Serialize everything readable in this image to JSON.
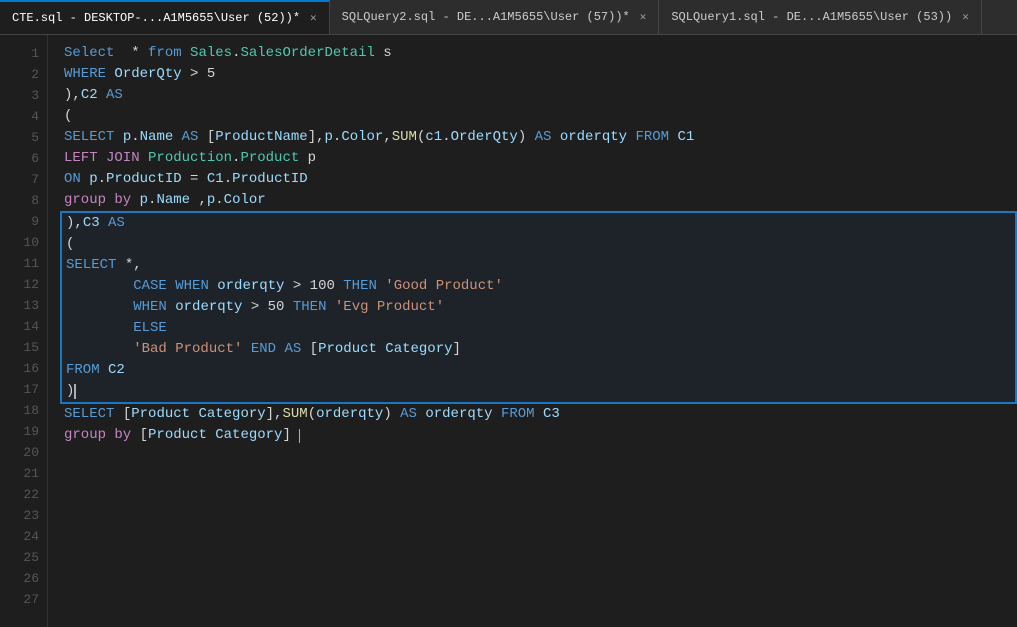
{
  "tabs": [
    {
      "id": "tab1",
      "label": "CTE.sql - DESKTOP-...A1M5655\\User (52))",
      "active": true,
      "modified": true
    },
    {
      "id": "tab2",
      "label": "SQLQuery2.sql - DE...A1M5655\\User (57))",
      "active": false,
      "modified": true
    },
    {
      "id": "tab3",
      "label": "SQLQuery1.sql - DE...A1M5655\\User (53))",
      "active": false,
      "modified": false
    }
  ],
  "lines": [
    {
      "num": 1,
      "content": ""
    },
    {
      "num": 2,
      "content": ""
    },
    {
      "num": 3,
      "content": ""
    },
    {
      "num": 4,
      "content": ""
    },
    {
      "num": 5,
      "content": ""
    },
    {
      "num": 6,
      "content": ""
    },
    {
      "num": 7,
      "content": ""
    },
    {
      "num": 8,
      "content": ""
    },
    {
      "num": 9,
      "content": ""
    },
    {
      "num": 10,
      "content": ""
    },
    {
      "num": 11,
      "content": ""
    },
    {
      "num": 12,
      "content": ""
    },
    {
      "num": 13,
      "content": ""
    },
    {
      "num": 14,
      "content": ""
    },
    {
      "num": 15,
      "content": ""
    },
    {
      "num": 16,
      "content": ""
    },
    {
      "num": 17,
      "content": ""
    },
    {
      "num": 18,
      "content": ""
    },
    {
      "num": 19,
      "content": ""
    },
    {
      "num": 20,
      "content": ""
    },
    {
      "num": 21,
      "content": ""
    },
    {
      "num": 22,
      "content": ""
    },
    {
      "num": 23,
      "content": ""
    },
    {
      "num": 24,
      "content": ""
    },
    {
      "num": 25,
      "content": ""
    },
    {
      "num": 26,
      "content": ""
    },
    {
      "num": 27,
      "content": ""
    }
  ]
}
